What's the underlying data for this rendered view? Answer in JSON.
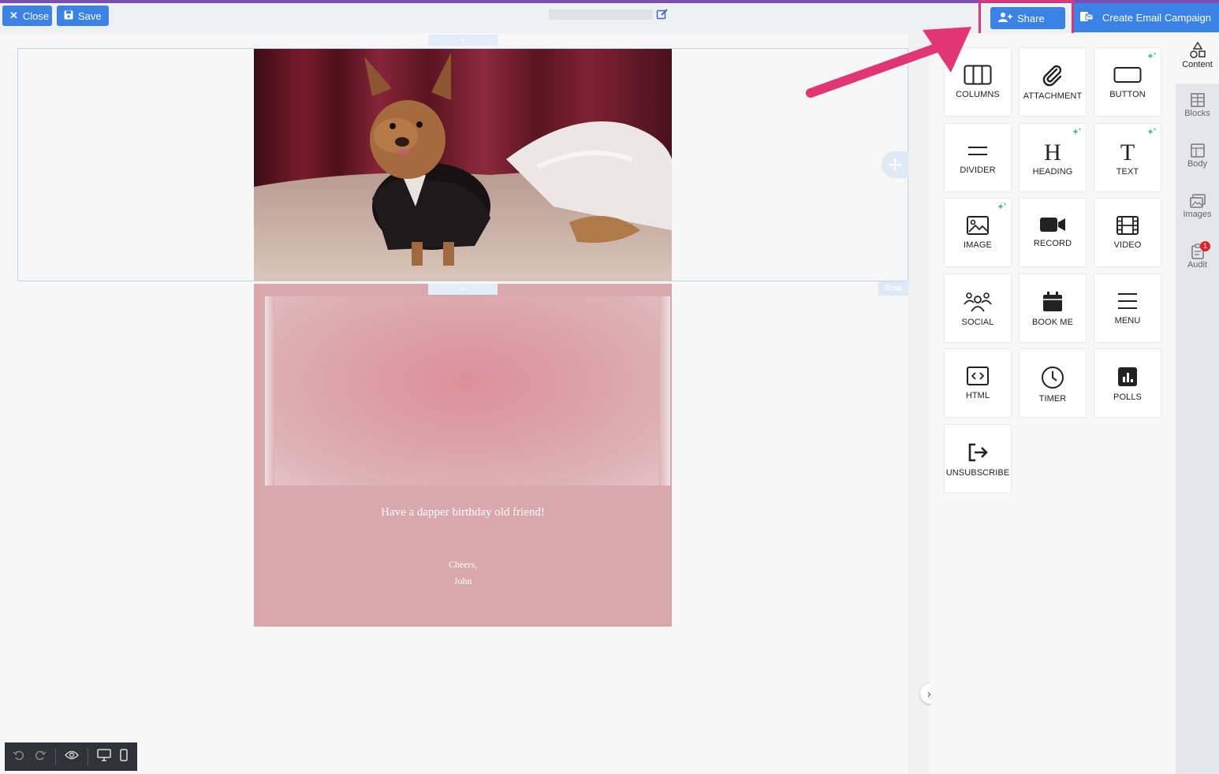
{
  "topbar": {
    "close_label": "Close",
    "save_label": "Save",
    "share_label": "Share",
    "campaign_label": "Create Email Campaign"
  },
  "canvas": {
    "row_label": "Row",
    "add_label": "+",
    "greeting": "Have a dapper birthday old friend!",
    "signoff_line1": "Cheers,",
    "signoff_line2": "John"
  },
  "content_tiles": [
    {
      "label": "COLUMNS",
      "icon": "columns-icon",
      "ai": false
    },
    {
      "label": "ATTACHMENT",
      "icon": "paperclip-icon",
      "ai": false
    },
    {
      "label": "BUTTON",
      "icon": "button-icon",
      "ai": true
    },
    {
      "label": "DIVIDER",
      "icon": "divider-icon",
      "ai": false
    },
    {
      "label": "HEADING",
      "icon": "heading-icon",
      "ai": true
    },
    {
      "label": "TEXT",
      "icon": "text-icon",
      "ai": true
    },
    {
      "label": "IMAGE",
      "icon": "image-icon",
      "ai": true
    },
    {
      "label": "RECORD",
      "icon": "video-camera-icon",
      "ai": false
    },
    {
      "label": "VIDEO",
      "icon": "film-icon",
      "ai": false
    },
    {
      "label": "SOCIAL",
      "icon": "people-icon",
      "ai": false
    },
    {
      "label": "BOOK ME",
      "icon": "calendar-icon",
      "ai": false
    },
    {
      "label": "MENU",
      "icon": "menu-icon",
      "ai": false
    },
    {
      "label": "HTML",
      "icon": "code-icon",
      "ai": false
    },
    {
      "label": "TIMER",
      "icon": "clock-icon",
      "ai": false
    },
    {
      "label": "POLLS",
      "icon": "poll-icon",
      "ai": false
    },
    {
      "label": "UNSUBSCRIBE",
      "icon": "exit-icon",
      "ai": false
    }
  ],
  "rail": {
    "content": "Content",
    "blocks": "Blocks",
    "body": "Body",
    "images": "Images",
    "audit": "Audit",
    "audit_badge": "1"
  },
  "colors": {
    "accent": "#3b82e6",
    "highlight": "#e23573",
    "card": "#d8a8aa"
  }
}
